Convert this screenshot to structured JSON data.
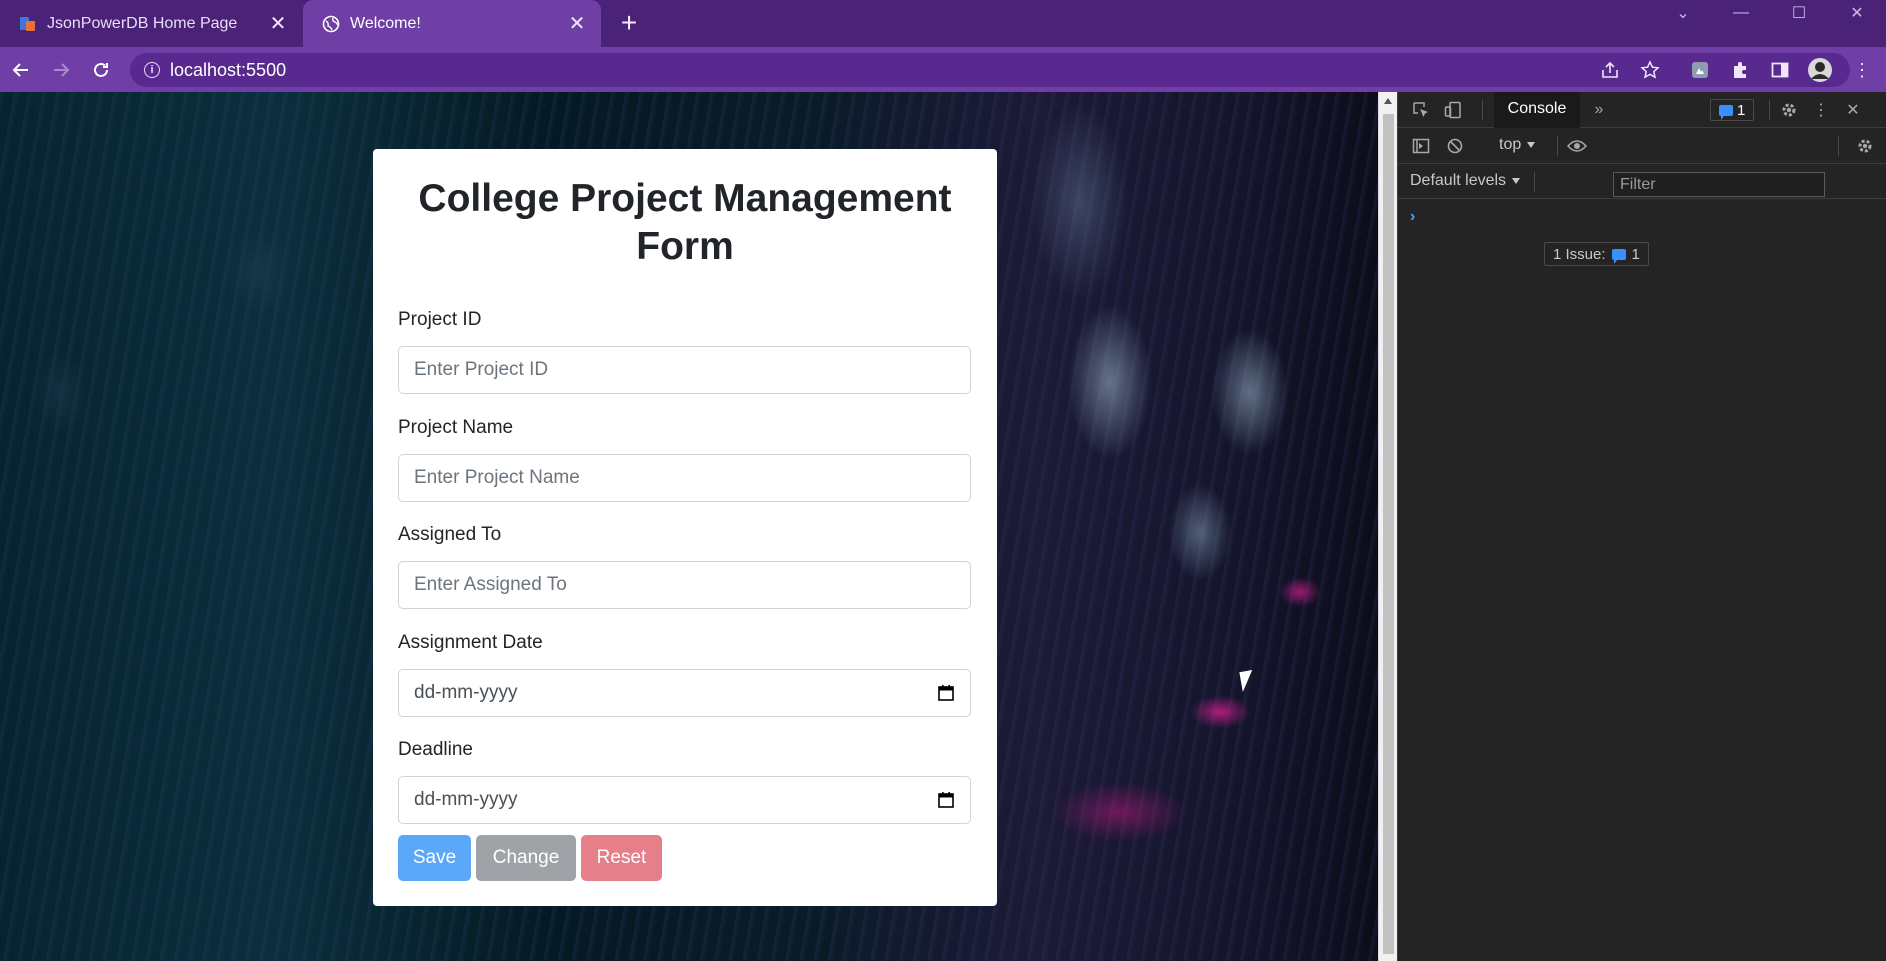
{
  "browser": {
    "tabs": [
      {
        "title": "JsonPowerDB Home Page",
        "active": false,
        "icon": "jsonpowerdb-favicon-icon"
      },
      {
        "title": "Welcome!",
        "active": true,
        "icon": "globe-icon"
      }
    ],
    "url": "localhost:5500",
    "accent_color": "#6f3fa6",
    "tabstrip_color": "#4a2277"
  },
  "form": {
    "title": "College Project Management Form",
    "fields": [
      {
        "label": "Project ID",
        "placeholder": "Enter Project ID",
        "type": "text"
      },
      {
        "label": "Project Name",
        "placeholder": "Enter Project Name",
        "type": "text"
      },
      {
        "label": "Assigned To",
        "placeholder": "Enter Assigned To",
        "type": "text"
      },
      {
        "label": "Assignment Date",
        "placeholder": "dd-mm-yyyy",
        "type": "date"
      },
      {
        "label": "Deadline",
        "placeholder": "dd-mm-yyyy",
        "type": "date"
      }
    ],
    "buttons": {
      "save": {
        "label": "Save",
        "color": "#5ba8f8"
      },
      "change": {
        "label": "Change",
        "color": "#9fa3a8"
      },
      "reset": {
        "label": "Reset",
        "color": "#e57f8a"
      }
    }
  },
  "devtools": {
    "active_tab": "Console",
    "issue_badge_count": "1",
    "context": "top",
    "filter_placeholder": "Filter",
    "levels": "Default levels",
    "issues_label": "1 Issue:",
    "issues_count": "1",
    "prompt": "›"
  }
}
